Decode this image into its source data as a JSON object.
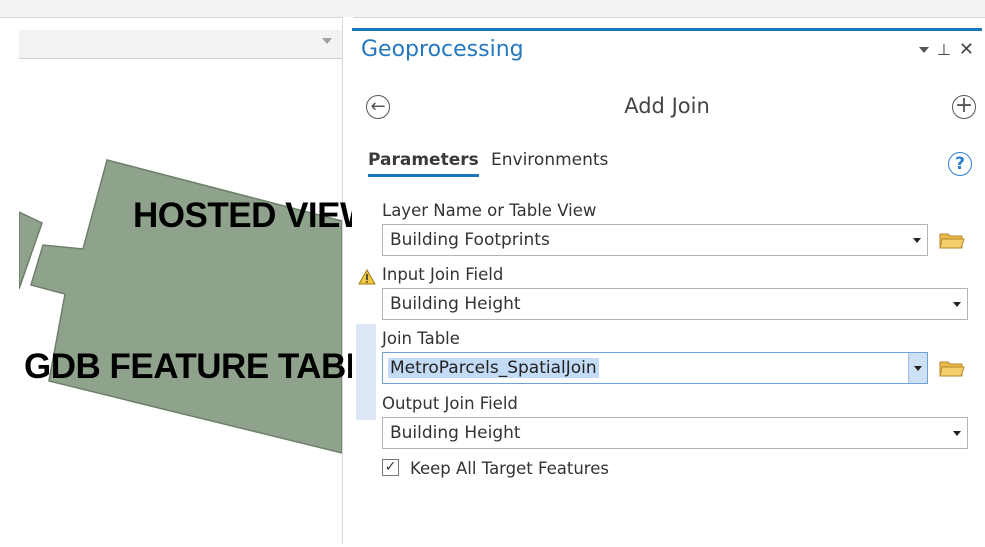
{
  "overlays": {
    "hosted_view": "HOSTED VIEW",
    "gdb_feature_table": "GDB FEATURE TABLE"
  },
  "pane": {
    "title": "Geoprocessing",
    "tool_title": "Add Join",
    "tabs": [
      "Parameters",
      "Environments"
    ],
    "active_tab": "Parameters",
    "accent_color": "#1b75bb"
  },
  "params": {
    "layer": {
      "label": "Layer Name or Table View",
      "value": "Building Footprints"
    },
    "input_join_field": {
      "label": "Input Join Field",
      "value": "Building Height",
      "warning": true
    },
    "join_table": {
      "label": "Join Table",
      "value": "MetroParcels_SpatialJoin"
    },
    "output_join_field": {
      "label": "Output Join Field",
      "value": "Building Height"
    },
    "keep_all": {
      "label": "Keep All Target Features",
      "checked": true
    }
  },
  "icons": {
    "back": "back-arrow-icon",
    "add": "plus-icon",
    "help": "help-icon",
    "folder": "folder-icon",
    "warning": "warning-icon"
  }
}
